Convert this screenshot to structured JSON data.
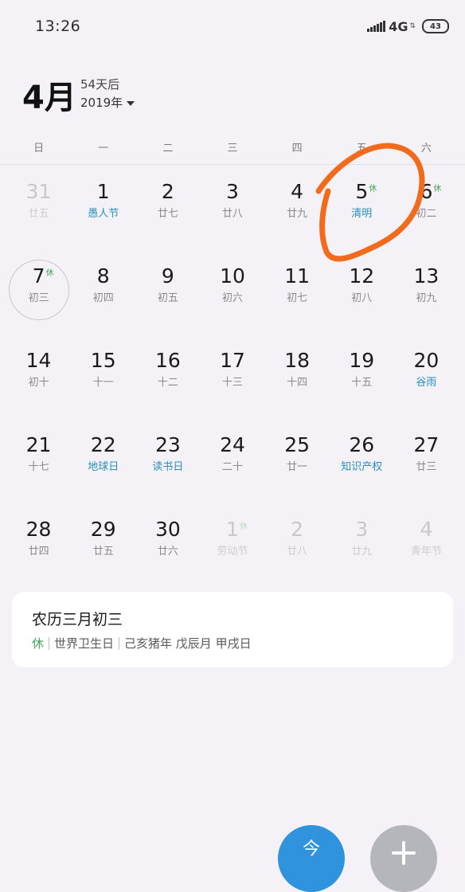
{
  "status_bar": {
    "time": "13:26",
    "network": "4G",
    "battery": "43",
    "signal_icon": "signal-bars-icon",
    "battery_icon": "battery-icon"
  },
  "header": {
    "month": "4月",
    "days_until": "54天后",
    "year": "2019年",
    "year_icon": "chevron-down-icon"
  },
  "weekdays": [
    "日",
    "一",
    "二",
    "三",
    "四",
    "五",
    "六"
  ],
  "calendar": {
    "days": [
      {
        "num": "31",
        "sub": "廿五",
        "other": true
      },
      {
        "num": "1",
        "sub": "愚人节",
        "holiday": true
      },
      {
        "num": "2",
        "sub": "廿七"
      },
      {
        "num": "3",
        "sub": "廿八"
      },
      {
        "num": "4",
        "sub": "廿九"
      },
      {
        "num": "5",
        "sub": "清明",
        "holiday": true,
        "badge": "休"
      },
      {
        "num": "6",
        "sub": "初二",
        "badge": "休"
      },
      {
        "num": "7",
        "sub": "初三",
        "badge": "休",
        "selected": true
      },
      {
        "num": "8",
        "sub": "初四"
      },
      {
        "num": "9",
        "sub": "初五"
      },
      {
        "num": "10",
        "sub": "初六"
      },
      {
        "num": "11",
        "sub": "初七"
      },
      {
        "num": "12",
        "sub": "初八"
      },
      {
        "num": "13",
        "sub": "初九"
      },
      {
        "num": "14",
        "sub": "初十"
      },
      {
        "num": "15",
        "sub": "十一"
      },
      {
        "num": "16",
        "sub": "十二"
      },
      {
        "num": "17",
        "sub": "十三"
      },
      {
        "num": "18",
        "sub": "十四"
      },
      {
        "num": "19",
        "sub": "十五"
      },
      {
        "num": "20",
        "sub": "谷雨",
        "holiday": true
      },
      {
        "num": "21",
        "sub": "十七"
      },
      {
        "num": "22",
        "sub": "地球日",
        "holiday": true
      },
      {
        "num": "23",
        "sub": "读书日",
        "holiday": true
      },
      {
        "num": "24",
        "sub": "二十"
      },
      {
        "num": "25",
        "sub": "廿一"
      },
      {
        "num": "26",
        "sub": "知识产权",
        "holiday": true
      },
      {
        "num": "27",
        "sub": "廿三"
      },
      {
        "num": "28",
        "sub": "廿四"
      },
      {
        "num": "29",
        "sub": "廿五"
      },
      {
        "num": "30",
        "sub": "廿六"
      },
      {
        "num": "1",
        "sub": "劳动节",
        "other": true,
        "badge": "休"
      },
      {
        "num": "2",
        "sub": "廿八",
        "other": true
      },
      {
        "num": "3",
        "sub": "廿九",
        "other": true
      },
      {
        "num": "4",
        "sub": "青年节",
        "other": true
      }
    ]
  },
  "info_card": {
    "title": "农历三月初三",
    "rest": "休",
    "festival": "世界卫生日",
    "ganzhi": "己亥猪年 戊辰月 甲戌日"
  },
  "fab": {
    "today_glyph": "今",
    "add_icon": "plus-icon"
  },
  "colors": {
    "background": "#f4f2f6",
    "holiday_text": "#2a8fc0",
    "rest_badge": "#43a35a",
    "annotation": "#f26a1b",
    "fab_blue": "#2f93dd",
    "fab_gray": "#b4b6bc"
  }
}
